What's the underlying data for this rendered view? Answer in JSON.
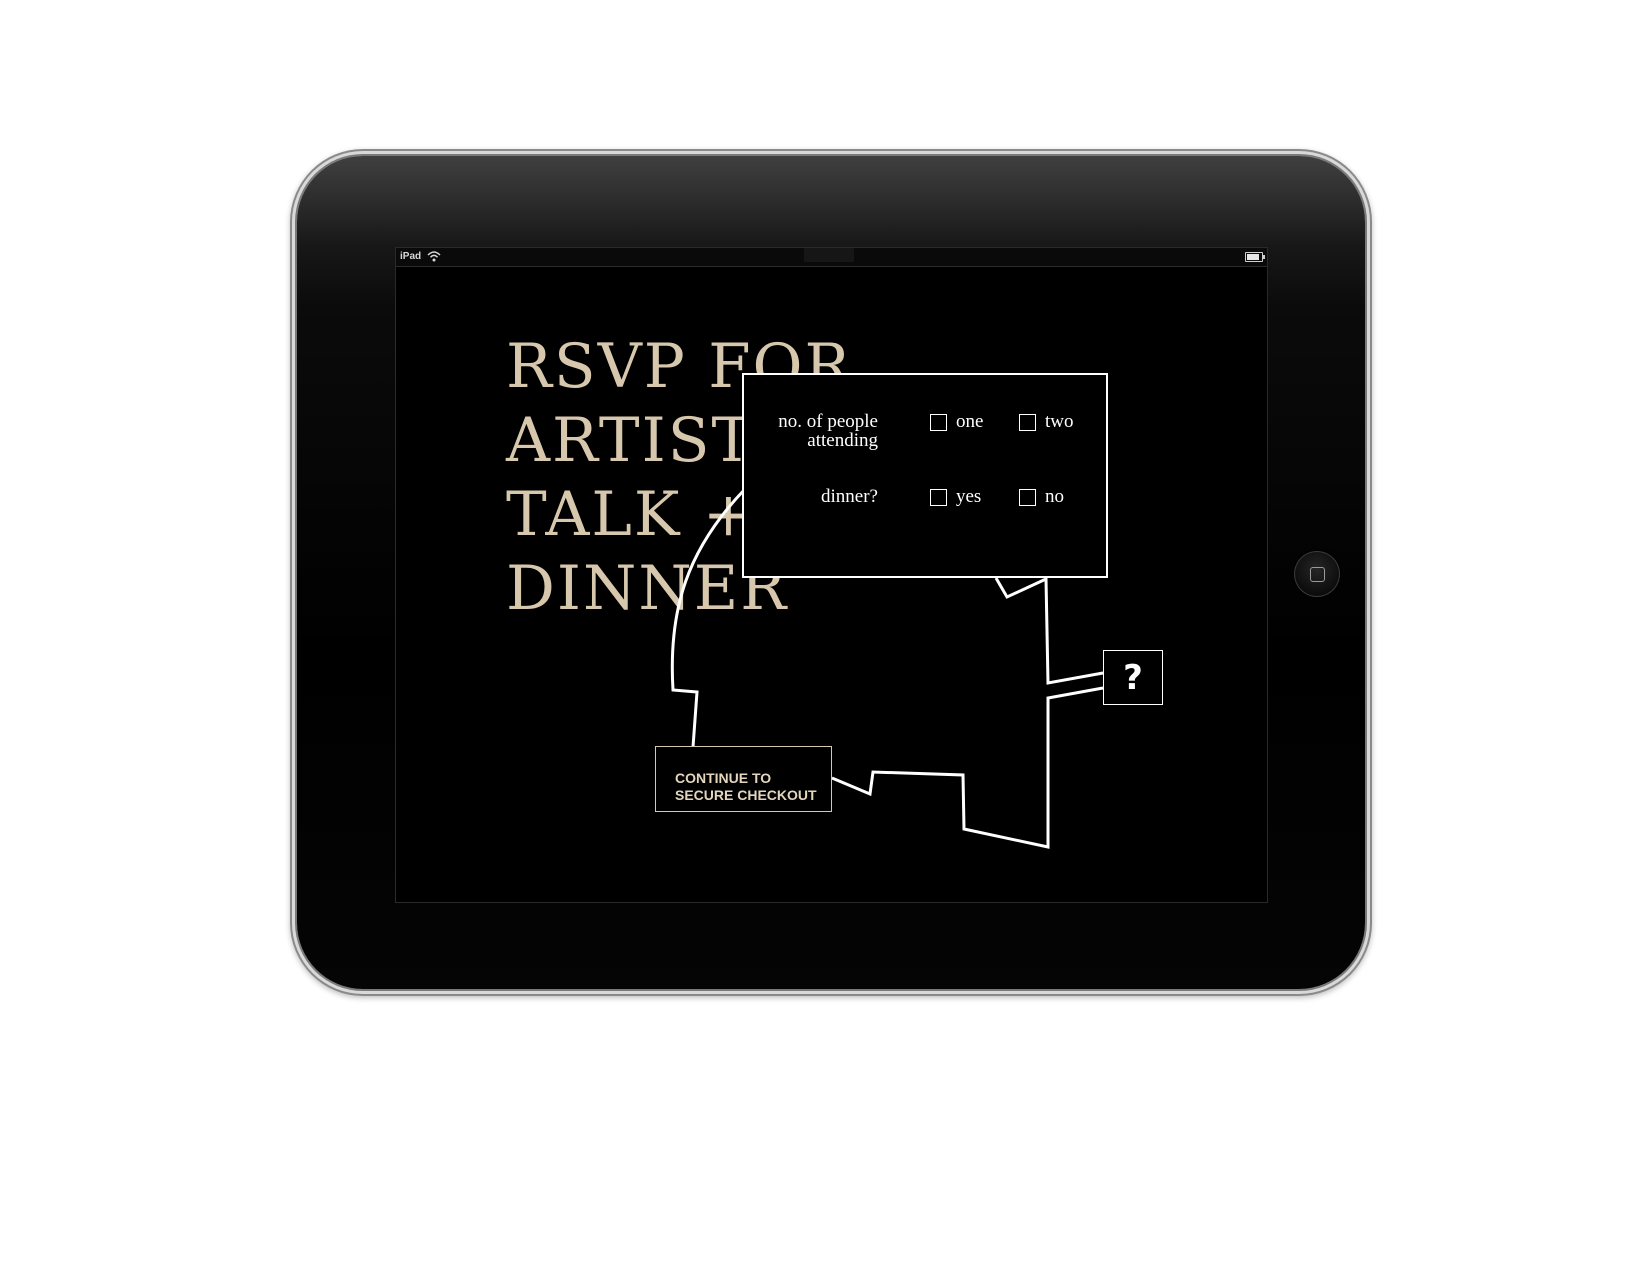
{
  "device": {
    "status_bar": {
      "carrier": "iPad",
      "wifi_icon": "wifi-icon",
      "battery_icon": "battery-icon"
    },
    "home_button_icon": "home-button-icon"
  },
  "page": {
    "title_lines": [
      "RSVP FOR",
      "ARTIST",
      "TALK +",
      "DINNER"
    ],
    "colors": {
      "background": "#000000",
      "title": "#d7c8ad",
      "outline": "#ffffff",
      "button_text": "#e3d6bd"
    }
  },
  "form": {
    "attendees": {
      "label_line1": "no. of people",
      "label_line2": "attending",
      "options": [
        "one",
        "two"
      ]
    },
    "dinner": {
      "label": "dinner?",
      "options": [
        "yes",
        "no"
      ]
    }
  },
  "help": {
    "label": "?"
  },
  "checkout": {
    "label_line1": "CONTINUE TO",
    "label_line2": "SECURE CHECKOUT"
  }
}
